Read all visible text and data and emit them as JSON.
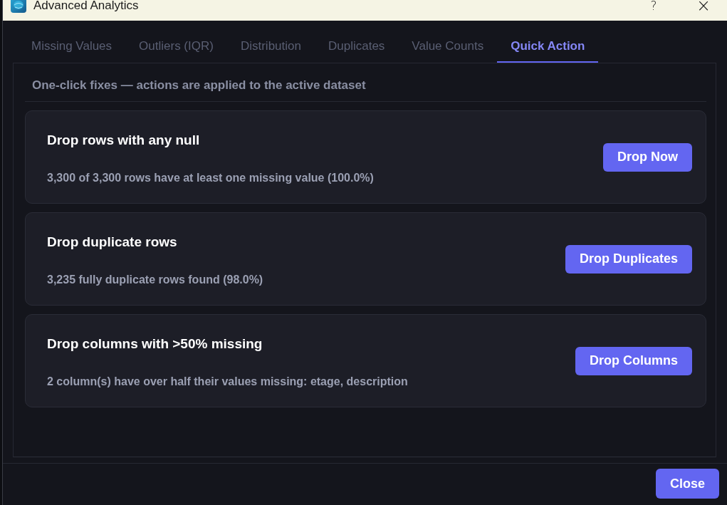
{
  "window": {
    "title": "Advanced Analytics",
    "help": "?",
    "close": "×"
  },
  "tabs": [
    {
      "label": "Missing Values",
      "selected": false
    },
    {
      "label": "Outliers (IQR)",
      "selected": false
    },
    {
      "label": "Distribution",
      "selected": false
    },
    {
      "label": "Duplicates",
      "selected": false
    },
    {
      "label": "Value Counts",
      "selected": false
    },
    {
      "label": "Quick Action",
      "selected": true
    }
  ],
  "panel": {
    "subtitle": "One-click fixes — actions are applied to the active dataset",
    "actions": [
      {
        "title": "Drop rows with any null",
        "description": "3,300 of 3,300 rows have at least one missing value (100.0%)",
        "button": "Drop Now"
      },
      {
        "title": "Drop duplicate rows",
        "description": "3,235 fully duplicate rows found (98.0%)",
        "button": "Drop Duplicates"
      },
      {
        "title": "Drop columns with >50% missing",
        "description": "2 column(s) have over half their values missing: etage, description",
        "button": "Drop Columns"
      }
    ]
  },
  "footer": {
    "buttons": [
      "Close"
    ]
  }
}
